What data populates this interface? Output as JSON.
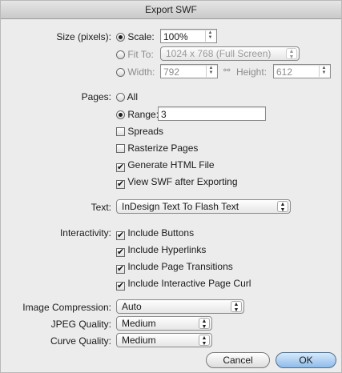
{
  "window": {
    "title": "Export SWF"
  },
  "size": {
    "label": "Size (pixels):",
    "scale": {
      "label": "Scale:",
      "value": "100%",
      "selected": true
    },
    "fit_to": {
      "label": "Fit To:",
      "value": "1024 x 768 (Full Screen)",
      "selected": false
    },
    "custom": {
      "width_label": "Width:",
      "width_value": "792",
      "height_label": "Height:",
      "height_value": "612",
      "selected": false
    }
  },
  "pages": {
    "label": "Pages:",
    "all_label": "All",
    "range_label": "Range:",
    "range_value": "3",
    "range_selected": true,
    "spreads_label": "Spreads",
    "spreads_checked": false,
    "rasterize_label": "Rasterize Pages",
    "rasterize_checked": false,
    "html_label": "Generate HTML File",
    "html_checked": true,
    "view_label": "View SWF after Exporting",
    "view_checked": true
  },
  "text": {
    "label": "Text:",
    "value": "InDesign Text To Flash Text"
  },
  "interactivity": {
    "label": "Interactivity:",
    "items": [
      {
        "label": "Include Buttons",
        "checked": true
      },
      {
        "label": "Include Hyperlinks",
        "checked": true
      },
      {
        "label": "Include Page Transitions",
        "checked": true
      },
      {
        "label": "Include Interactive Page Curl",
        "checked": true
      }
    ]
  },
  "image_compression": {
    "label": "Image Compression:",
    "value": "Auto"
  },
  "jpeg_quality": {
    "label": "JPEG Quality:",
    "value": "Medium"
  },
  "curve_quality": {
    "label": "Curve Quality:",
    "value": "Medium"
  },
  "buttons": {
    "cancel": "Cancel",
    "ok": "OK"
  },
  "icons": {
    "checkmark": "✔",
    "link": "chain-link-icon"
  }
}
